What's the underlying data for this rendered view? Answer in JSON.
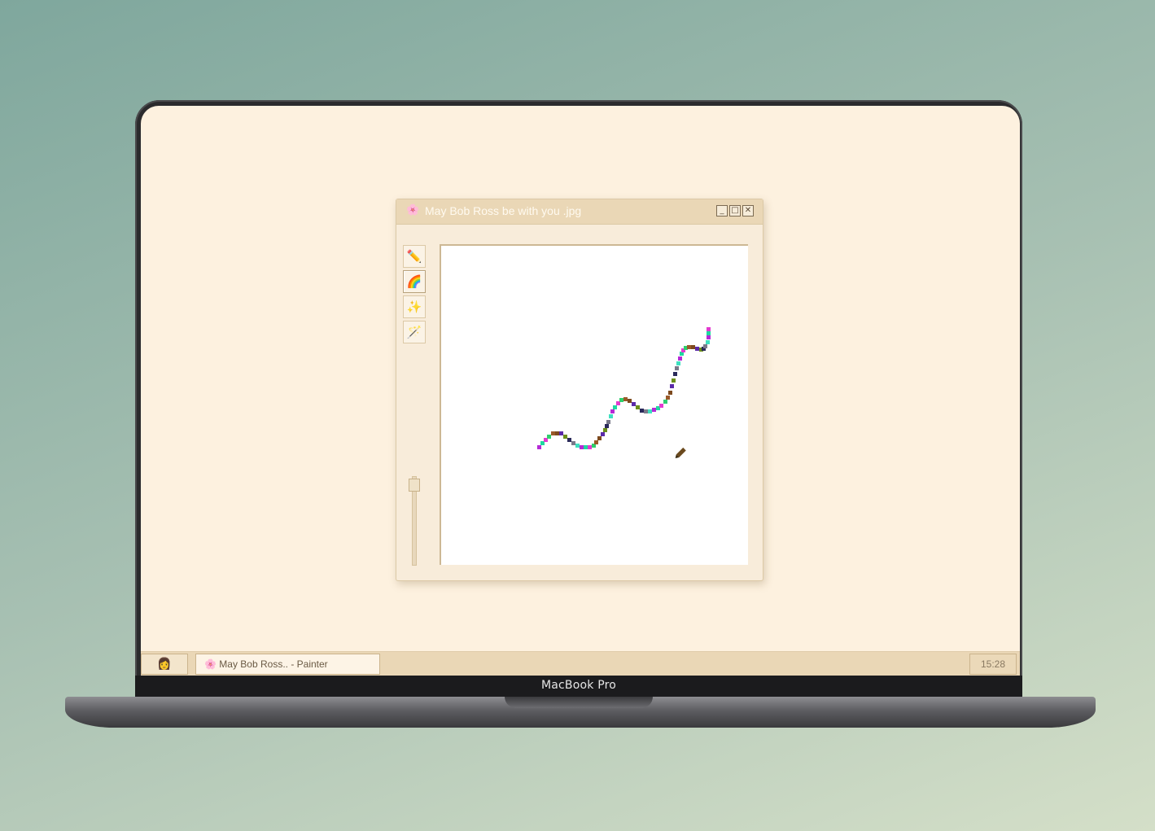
{
  "device": {
    "brand_label": "MacBook Pro"
  },
  "window": {
    "title": "May Bob Ross be with you .jpg",
    "title_icon": "🌸",
    "buttons": {
      "minimize": "_",
      "maximize": "□",
      "close": "✕"
    }
  },
  "tools": [
    {
      "name": "pencil",
      "glyph": "✏️",
      "active": false
    },
    {
      "name": "rainbow",
      "glyph": "🌈",
      "active": true
    },
    {
      "name": "sparkles",
      "glyph": "✨",
      "active": false
    },
    {
      "name": "magic-wand",
      "glyph": "🪄",
      "active": false
    }
  ],
  "brush_size_level": 0.95,
  "taskbar": {
    "start_glyph": "👩",
    "task_icon": "🌸",
    "task_label": "May Bob Ross.. - Painter",
    "clock": "15:28"
  },
  "colors": {
    "screen_bg": "#fdf1df",
    "chrome": "#ead7b6",
    "stroke_palette": [
      "#7a7a8a",
      "#5b2aa8",
      "#2ecf6e",
      "#b52ad6",
      "#2a2a5a",
      "#7d4a1e",
      "#e33ad0",
      "#3fe0c0",
      "#6b8f1a",
      "#9a5a2a",
      "#1fd8a0"
    ]
  }
}
